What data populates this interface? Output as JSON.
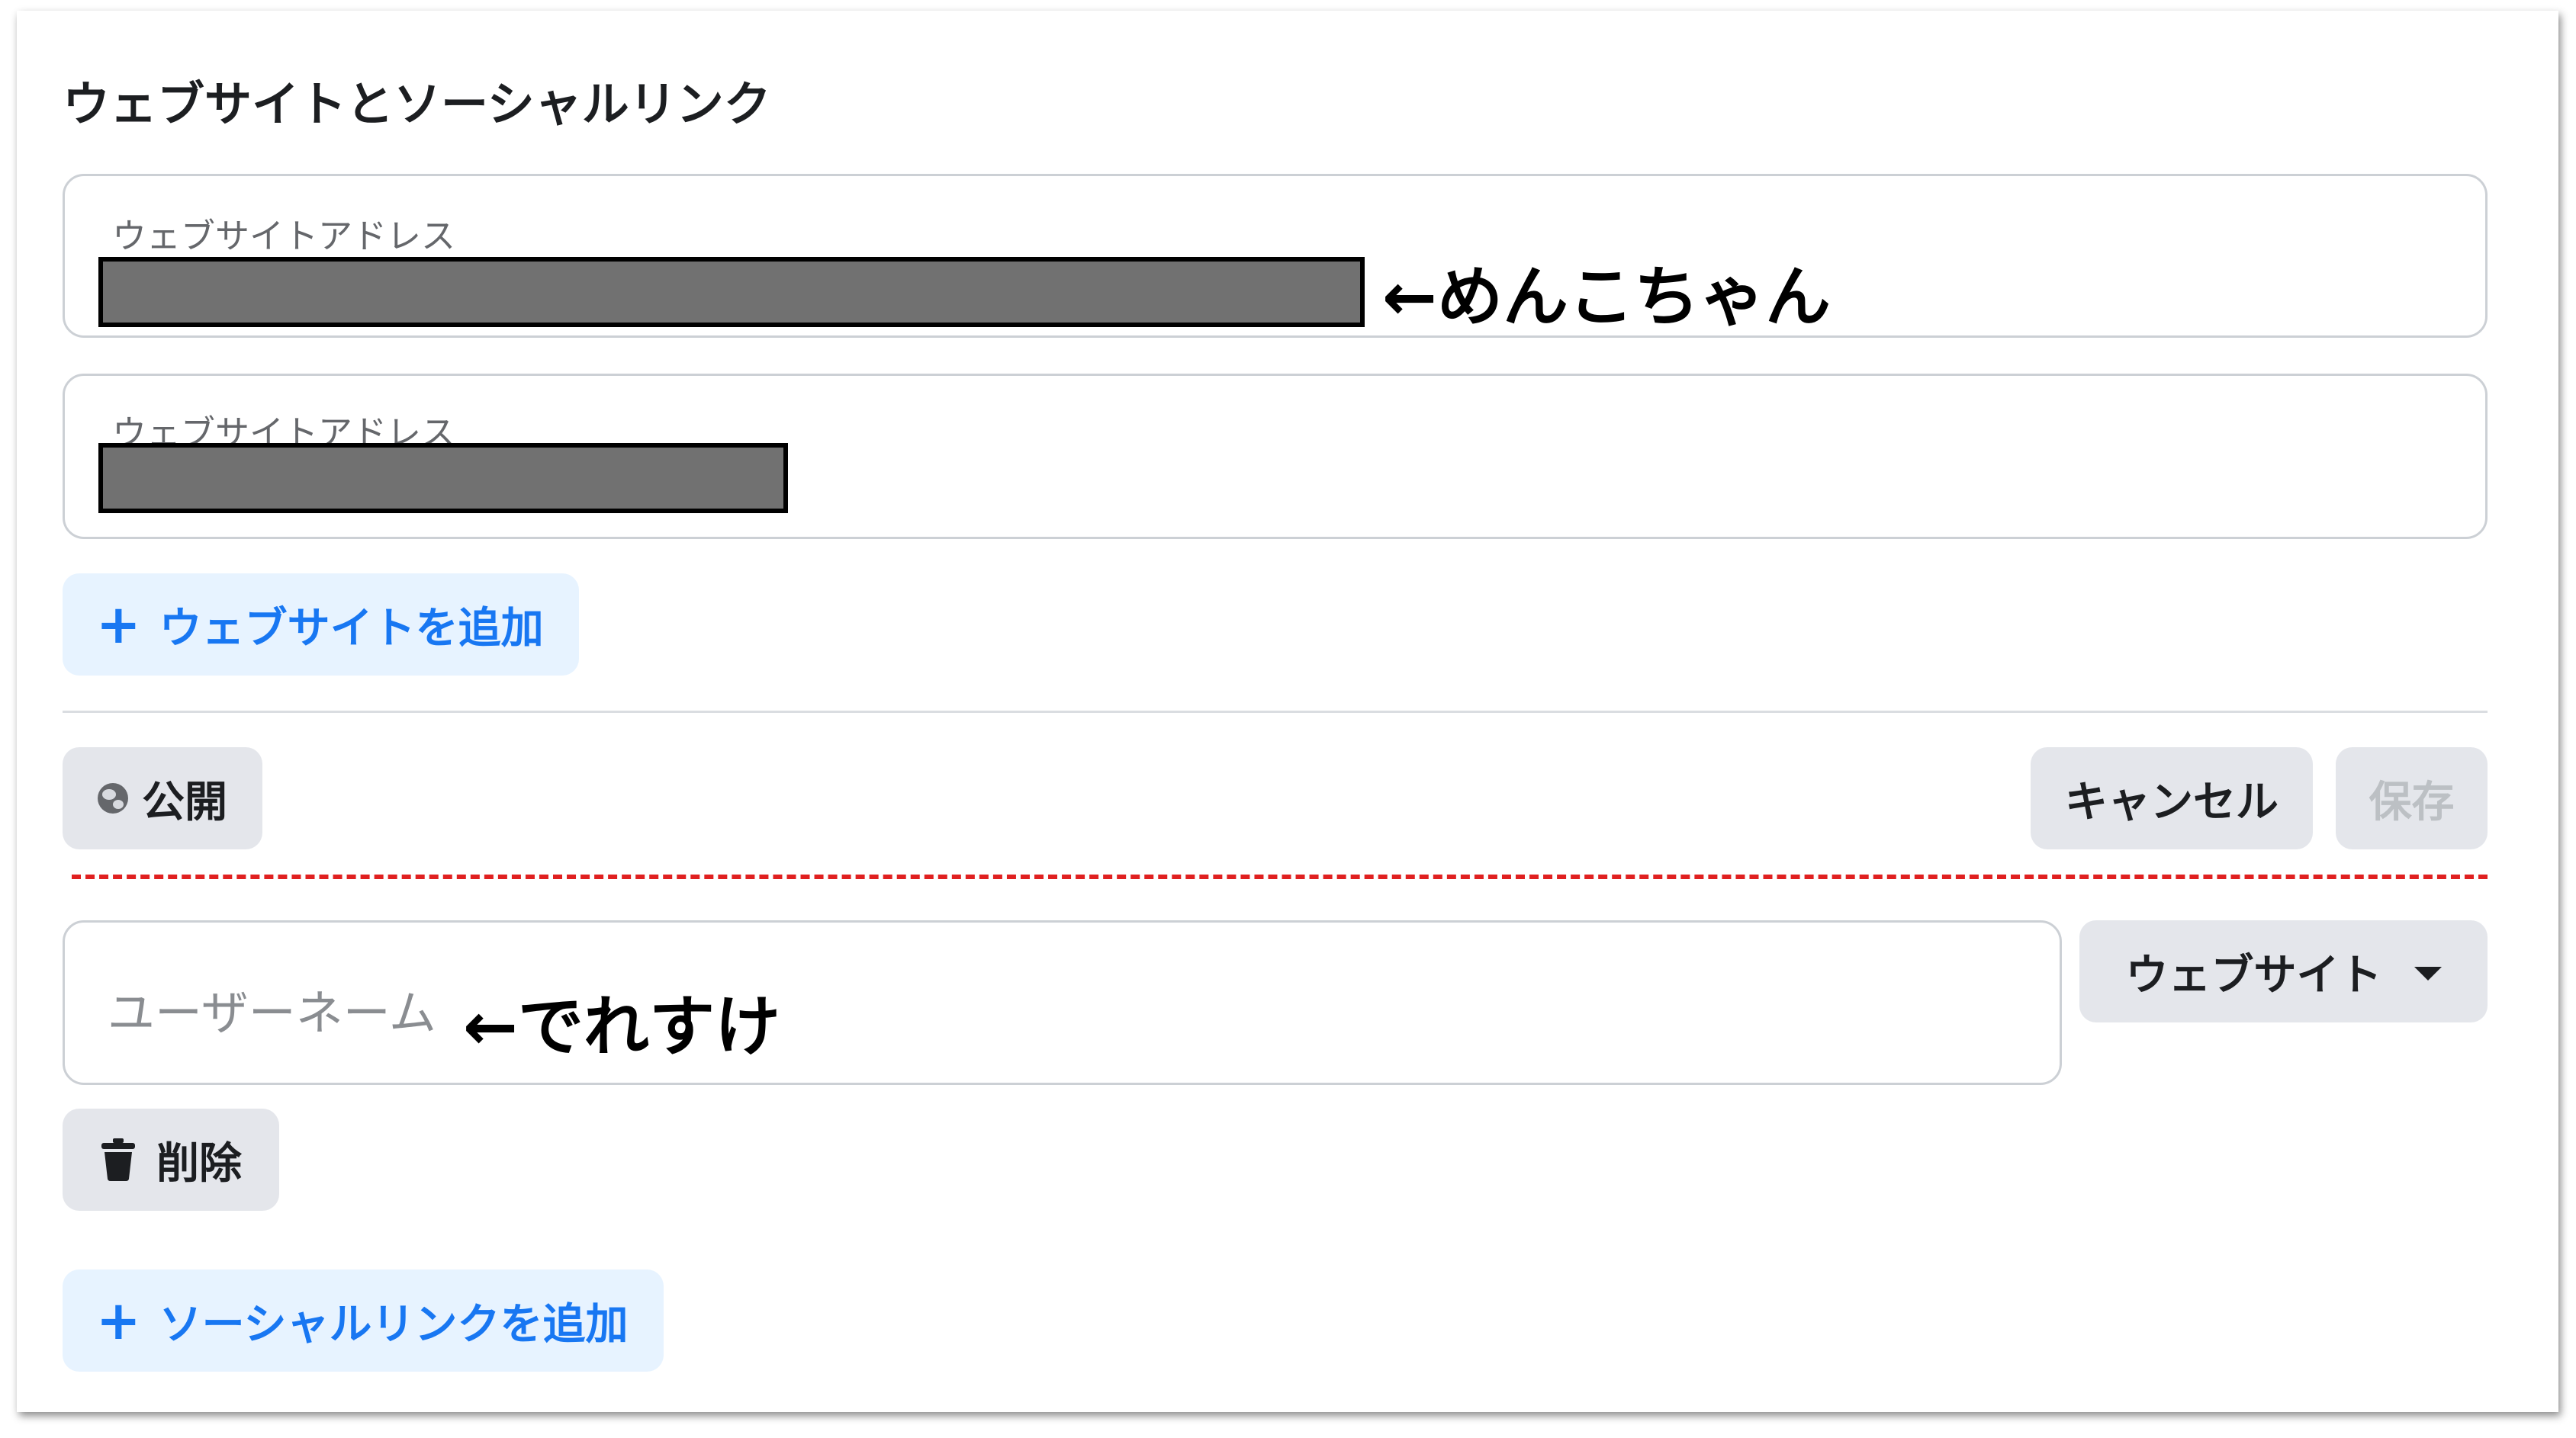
{
  "section": {
    "title": "ウェブサイトとソーシャルリンク"
  },
  "websites": {
    "fields": [
      {
        "label": "ウェブサイトアドレス",
        "annotation": "←めんこちゃん"
      },
      {
        "label": "ウェブサイトアドレス"
      }
    ],
    "add_label": "ウェブサイトを追加",
    "plus": "+"
  },
  "actions": {
    "privacy_label": "公開",
    "cancel_label": "キャンセル",
    "save_label": "保存"
  },
  "social": {
    "username_placeholder": "ユーザーネーム",
    "annotation": "←でれすけ",
    "platform_label": "ウェブサイト",
    "delete_label": "削除",
    "add_label": "ソーシャルリンクを追加",
    "plus": "+"
  },
  "colors": {
    "accent": "#1877f2",
    "accent_bg": "#e7f3ff",
    "button_bg": "#e4e6eb",
    "disabled_text": "#bcc0c4",
    "separator_dashed": "#e02020"
  }
}
